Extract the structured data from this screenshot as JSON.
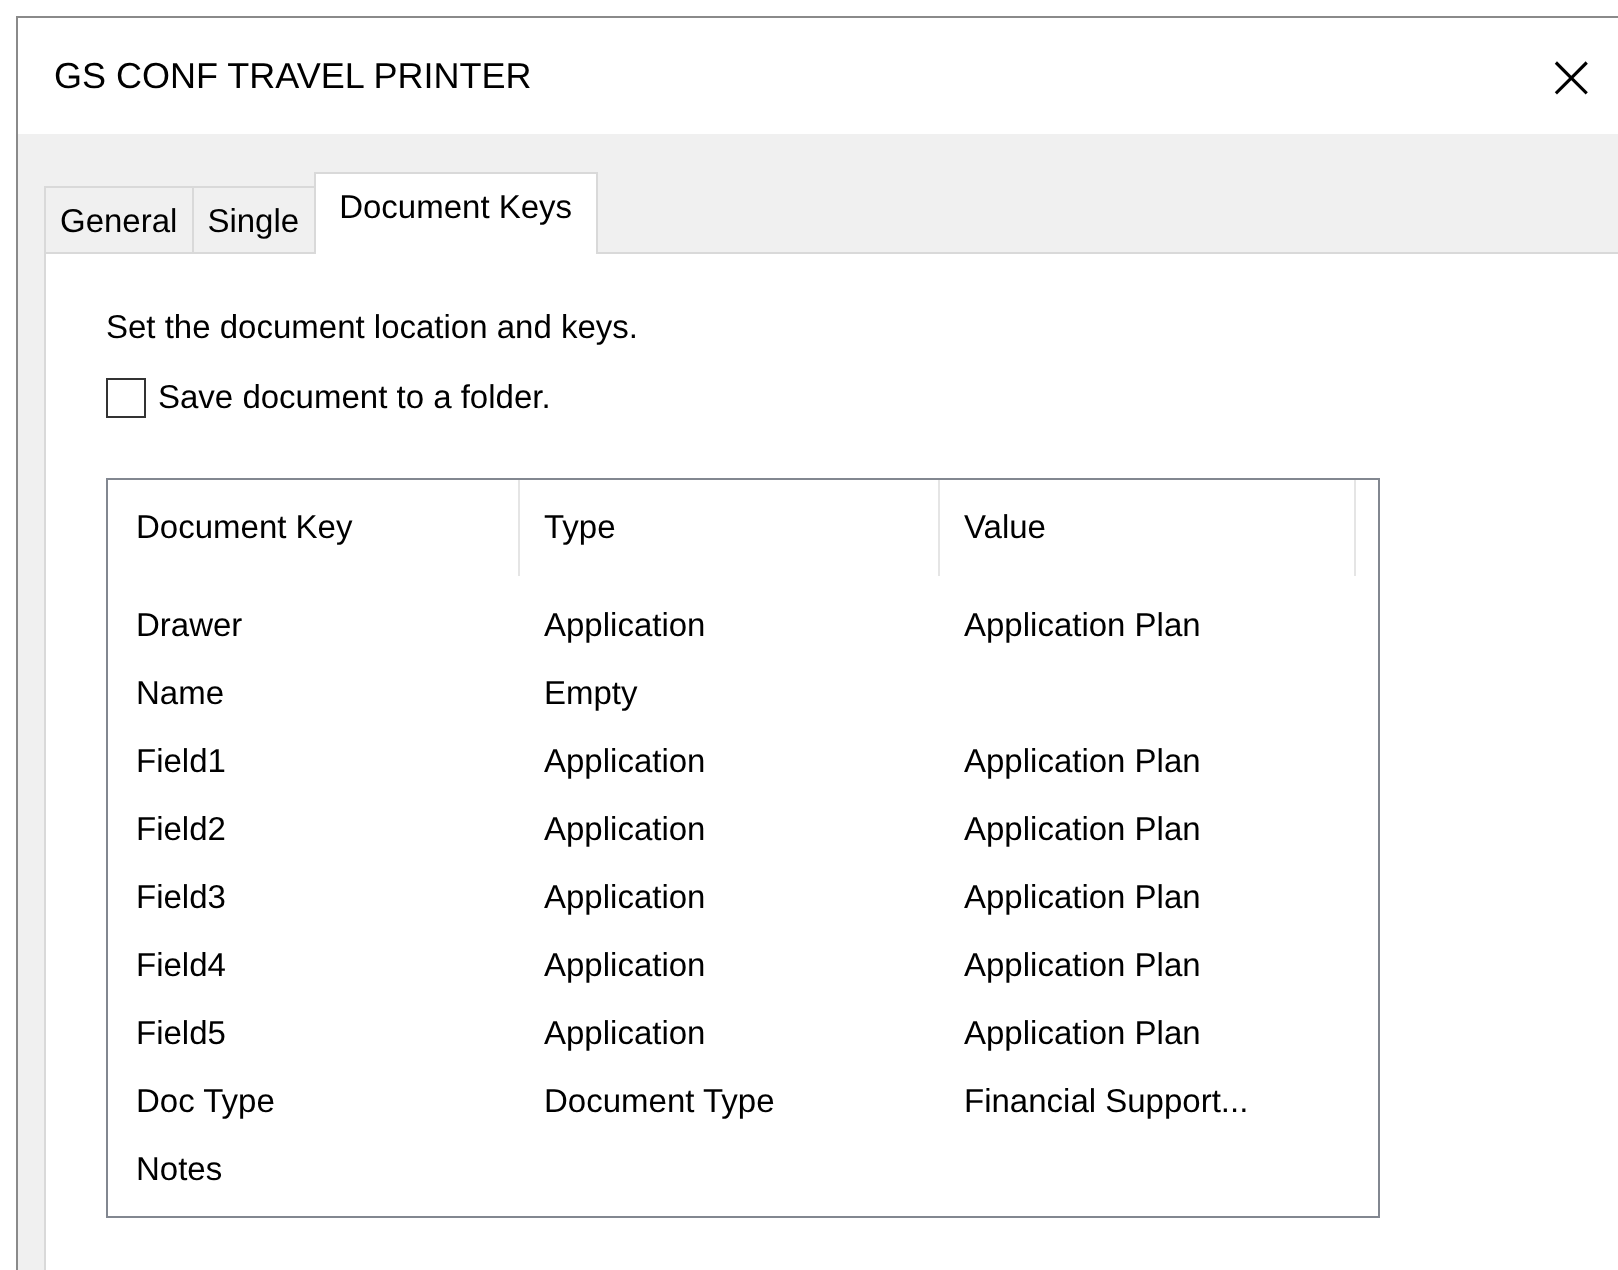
{
  "window": {
    "title": "GS CONF TRAVEL PRINTER",
    "close": "×"
  },
  "tabs": [
    {
      "label": "General",
      "selected": false
    },
    {
      "label": "Single",
      "selected": false
    },
    {
      "label": "Document Keys",
      "selected": true
    }
  ],
  "instruction": "Set the document location and keys.",
  "save_checkbox": {
    "label": "Save document to a folder.",
    "checked": false
  },
  "table": {
    "columns": [
      "Document Key",
      "Type",
      "Value"
    ],
    "rows": [
      [
        "Drawer",
        "Application",
        "Application Plan"
      ],
      [
        "Name",
        "Empty"
      ],
      [
        "Field1",
        "Application",
        "Application Plan"
      ],
      [
        "Field2",
        "Application",
        "Application Plan"
      ],
      [
        "Field3",
        "Application",
        "Application Plan"
      ],
      [
        "Field4",
        "Application",
        "Application Plan"
      ],
      [
        "Field5",
        "Application",
        "Application Plan"
      ],
      [
        "Doc Type",
        "Document Type",
        "Financial Support..."
      ],
      [
        "Notes"
      ]
    ]
  }
}
